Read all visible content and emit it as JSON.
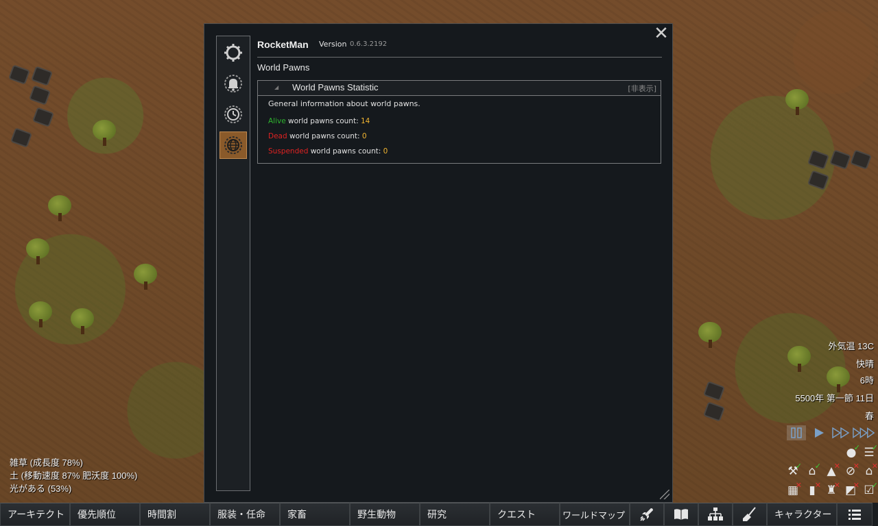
{
  "window": {
    "app_title": "RocketMan",
    "version_label": "Version",
    "version_value": "0.6.3.2192",
    "section_title": "World Pawns",
    "tabs": [
      {
        "icon": "gear-icon",
        "active": false
      },
      {
        "icon": "bell-icon",
        "active": false
      },
      {
        "icon": "clock-icon",
        "active": false
      },
      {
        "icon": "globe-icon",
        "active": true
      }
    ],
    "panel": {
      "title": "World Pawns Statistic",
      "hide_label": "[非表示]",
      "description": "General information about world pawns.",
      "stats": [
        {
          "status": "Alive",
          "status_color": "#2fb52f",
          "label": " world pawns count: ",
          "value": "14"
        },
        {
          "status": "Dead",
          "status_color": "#e02222",
          "label": " world pawns count: ",
          "value": "0"
        },
        {
          "status": "Suspended",
          "status_color": "#e02222",
          "label": " world pawns count: ",
          "value": "0"
        }
      ]
    }
  },
  "terrain_info": {
    "line1": "雑草 (成長度  78%)",
    "line2": "土 (移動速度 87% 肥沃度 100%)",
    "line3": "光がある (53%)"
  },
  "env_info": {
    "temperature": "外気温 13C",
    "weather": "快晴",
    "hour": "6時",
    "date": "5500年 第一節 11日",
    "season": "春"
  },
  "time_controls": [
    "pause-icon",
    "play-icon",
    "fast-icon",
    "superfast-icon"
  ],
  "toggles": [
    {
      "icon": "bubble-icon",
      "state": "ok"
    },
    {
      "icon": "list-icon",
      "state": "ok"
    },
    {
      "icon": "hammer-icon",
      "state": "ok"
    },
    {
      "icon": "home-icon",
      "state": "ok"
    },
    {
      "icon": "mountain-icon",
      "state": "no"
    },
    {
      "icon": "compass-icon",
      "state": "no"
    },
    {
      "icon": "roof-icon",
      "state": "no"
    },
    {
      "icon": "grid-icon",
      "state": "no"
    },
    {
      "icon": "barchart-icon",
      "state": "no"
    },
    {
      "icon": "person-icon",
      "state": "no"
    },
    {
      "icon": "zone-icon",
      "state": "no"
    },
    {
      "icon": "checklist-icon",
      "state": "ok"
    }
  ],
  "bottom_bar": {
    "architect": "アーキテクト",
    "priorities": "優先順位",
    "schedule": "時間割",
    "assign": "服装・任命",
    "animals": "家畜",
    "wildlife": "野生動物",
    "research": "研究",
    "quests": "クエスト",
    "world": "ワールドマップ",
    "characters": "キャラクター"
  }
}
